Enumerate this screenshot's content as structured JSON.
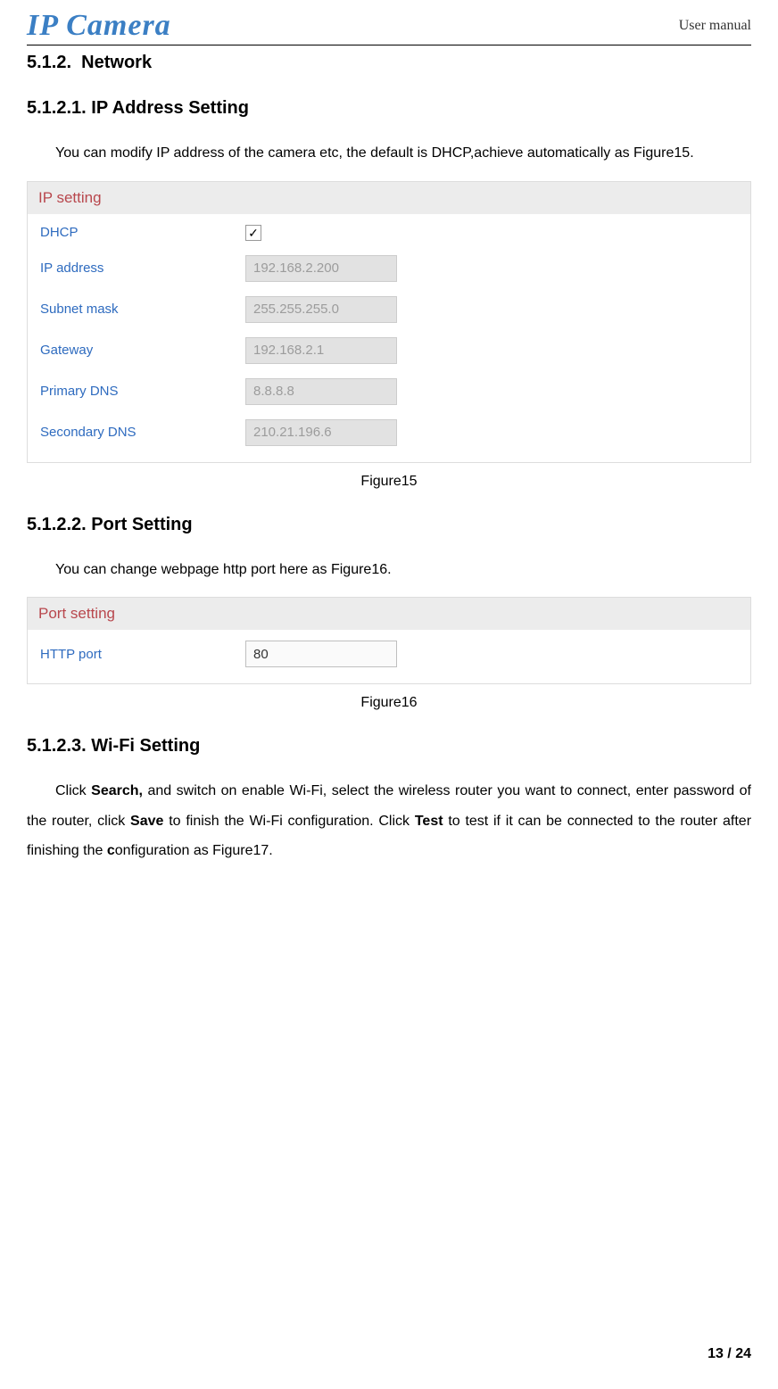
{
  "header": {
    "logo": "IP Camera",
    "doc_title": "User manual"
  },
  "section512": {
    "number": "5.1.2.",
    "title": "Network"
  },
  "section5121": {
    "number": "5.1.2.1.",
    "title": "IP Address Setting",
    "para": "You can modify IP address of the camera etc, the default is DHCP,achieve automatically as Figure15.",
    "panel_title": "IP setting",
    "fields": {
      "dhcp_label": "DHCP",
      "dhcp_checked": "✓",
      "ip_label": "IP address",
      "ip_value": "192.168.2.200",
      "subnet_label": "Subnet mask",
      "subnet_value": "255.255.255.0",
      "gateway_label": "Gateway",
      "gateway_value": "192.168.2.1",
      "pdns_label": "Primary DNS",
      "pdns_value": "8.8.8.8",
      "sdns_label": "Secondary DNS",
      "sdns_value": "210.21.196.6"
    },
    "caption": "Figure15"
  },
  "section5122": {
    "number": "5.1.2.2.",
    "title": "Port Setting",
    "para": "You can change webpage http port here as Figure16.",
    "panel_title": "Port setting",
    "fields": {
      "http_label": "HTTP port",
      "http_value": "80"
    },
    "caption": "Figure16"
  },
  "section5123": {
    "number": "5.1.2.3.",
    "title": "Wi-Fi Setting",
    "para_pre": "Click ",
    "search_bold": "Search,",
    "para_mid1": " and switch on enable Wi-Fi, select the wireless router you want to connect, enter password of the router, click ",
    "save_bold": "Save",
    "para_mid2": " to finish the Wi-Fi configuration. Click ",
    "test_bold": "Test",
    "para_post": " to test if it can be connected to the router after finishing the ",
    "c_bold": "c",
    "para_end": "onfiguration as Figure17."
  },
  "footer": {
    "page": "13 / 24"
  }
}
